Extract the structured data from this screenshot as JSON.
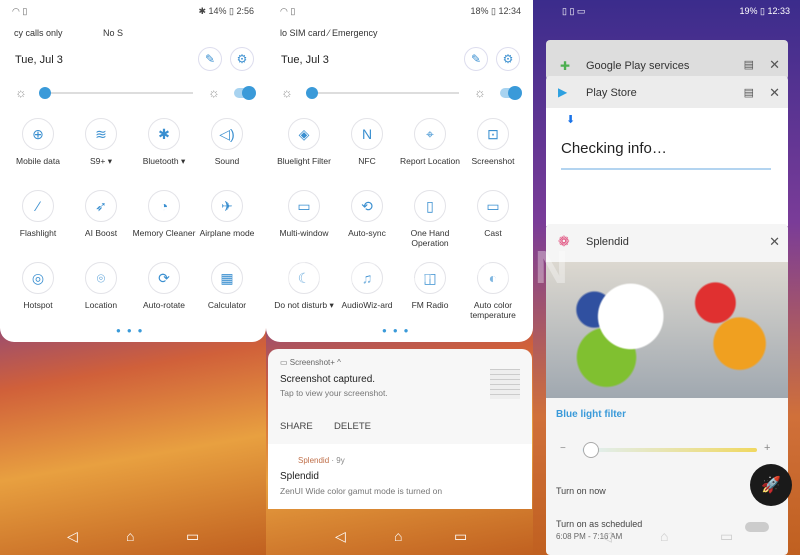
{
  "panel1": {
    "status": {
      "left": "wifi sim",
      "right": "✱ 14% ▯ 2:56"
    },
    "carrier_left": "cy calls only",
    "carrier_right": "No S",
    "date": "Tue, Jul 3",
    "tiles": [
      {
        "label": "Mobile data",
        "icon": "⊕"
      },
      {
        "label": "S9+ ▾",
        "icon": "≋"
      },
      {
        "label": "Bluetooth ▾",
        "icon": "✱"
      },
      {
        "label": "Sound",
        "icon": "◁)"
      },
      {
        "label": "Flashlight",
        "icon": "⁄"
      },
      {
        "label": "AI Boost",
        "icon": "➶"
      },
      {
        "label": "Memory Cleaner",
        "icon": "◔"
      },
      {
        "label": "Airplane mode",
        "icon": "✈"
      },
      {
        "label": "Hotspot",
        "icon": "◎"
      },
      {
        "label": "Location",
        "icon": "⌾"
      },
      {
        "label": "Auto-rotate",
        "icon": "⟳"
      },
      {
        "label": "Calculator",
        "icon": "▦"
      }
    ]
  },
  "panel2": {
    "status": {
      "right": "18% ▯ 12:34"
    },
    "carrier": "lo SIM card ⁄ Emergency",
    "date": "Tue, Jul 3",
    "tiles": [
      {
        "label": "Bluelight Filter",
        "icon": "◈"
      },
      {
        "label": "NFC",
        "icon": "N"
      },
      {
        "label": "Report Location",
        "icon": "⌖"
      },
      {
        "label": "Screenshot",
        "icon": "⊡"
      },
      {
        "label": "Multi-window",
        "icon": "▭"
      },
      {
        "label": "Auto-sync",
        "icon": "⟲"
      },
      {
        "label": "One Hand Operation",
        "icon": "▯"
      },
      {
        "label": "Cast",
        "icon": "▭"
      },
      {
        "label": "Do not disturb ▾",
        "icon": "☾"
      },
      {
        "label": "AudioWiz-ard",
        "icon": "♫"
      },
      {
        "label": "FM Radio",
        "icon": "◫"
      },
      {
        "label": "Auto color temperature",
        "icon": "◐"
      }
    ],
    "notification1": {
      "app": "Screenshot+ ^",
      "title": "Screenshot captured.",
      "text": "Tap to view your screenshot.",
      "share": "SHARE",
      "delete": "DELETE"
    },
    "notification2": {
      "app": "Splendid",
      "time": "· 9y",
      "title": "Splendid",
      "text": "ZenUI Wide color gamut mode is turned on"
    }
  },
  "panel3": {
    "status": {
      "right": "19% ▯ 12:33"
    },
    "recents": [
      {
        "title": "Google Play services"
      },
      {
        "title": "Play Store",
        "content": "Checking info…"
      },
      {
        "title": "Splendid"
      }
    ],
    "blue_light": {
      "title": "Blue light filter",
      "minus": "−",
      "plus": "+",
      "level": 0.05,
      "turn_on_now": "Turn on now",
      "scheduled": "Turn on as scheduled",
      "schedule_time": "6:08 PM - 7:16 AM"
    }
  },
  "watermark": "MOBIGYAAN",
  "nav": {
    "back": "◁",
    "home": "⌂",
    "recents": "▭"
  }
}
